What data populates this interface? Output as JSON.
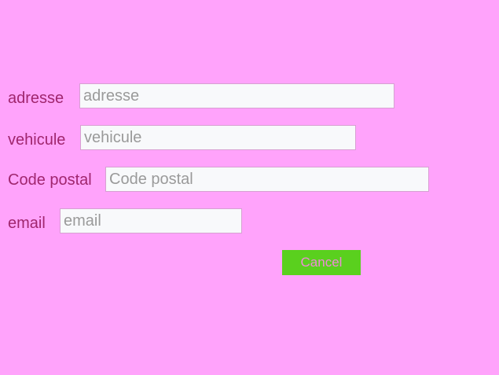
{
  "form": {
    "fields": [
      {
        "label": "adresse",
        "placeholder": "adresse",
        "value": ""
      },
      {
        "label": "vehicule",
        "placeholder": "vehicule",
        "value": ""
      },
      {
        "label": "Code postal",
        "placeholder": "Code postal",
        "value": ""
      },
      {
        "label": "email",
        "placeholder": "email",
        "value": ""
      }
    ],
    "cancel_label": "Cancel"
  },
  "colors": {
    "background": "#ffa3fb",
    "label": "#a0266e",
    "input_background": "#f8f9fb",
    "button_background": "#5ad01e",
    "button_text": "#f08ad8"
  }
}
